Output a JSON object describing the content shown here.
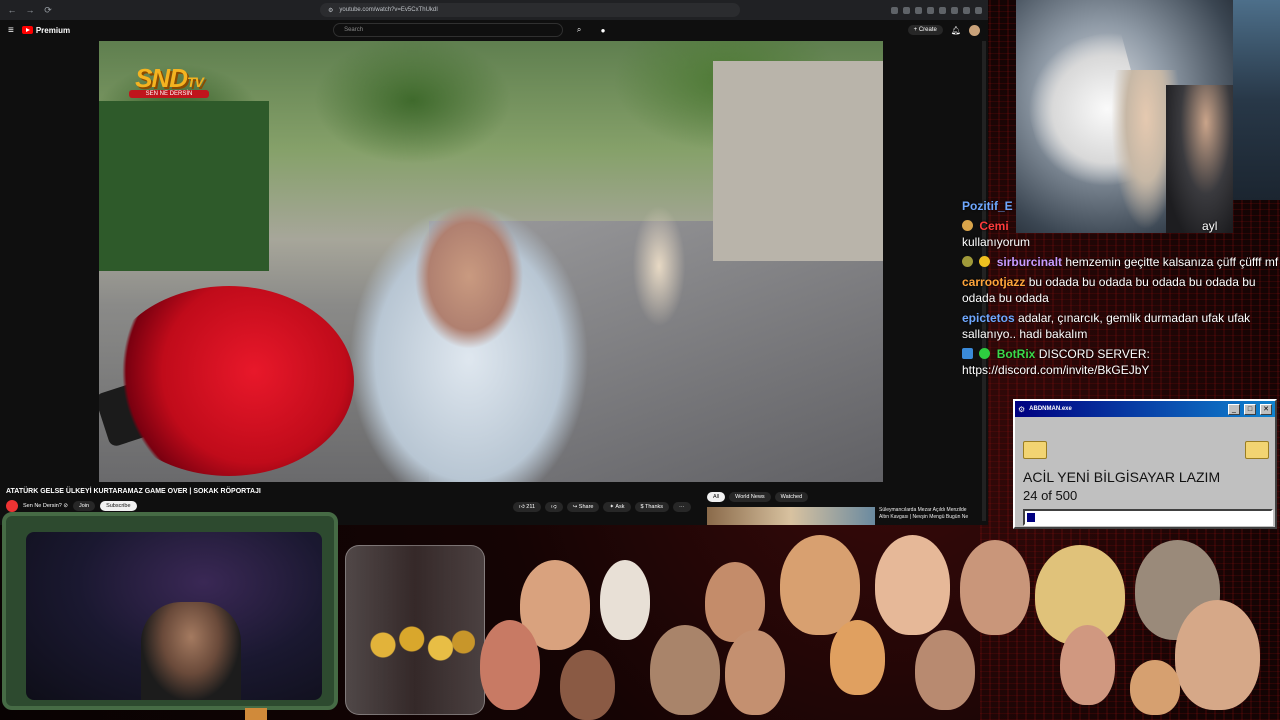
{
  "browser": {
    "url": "youtube.com/watch?v=Ev5CxThUkdI",
    "nav": {
      "back": "←",
      "forward": "→",
      "reload": "⟳"
    }
  },
  "youtube": {
    "logo_label": "Premium",
    "search_placeholder": "Search",
    "create_label": "+ Create",
    "video": {
      "overlay_logo": "SND",
      "overlay_logo_tv": "TV",
      "overlay_banner": "SEN NE DERSİN",
      "title": "ATATÜRK GELSE ÜLKEYİ KURTARAMAZ GAME OVER | SOKAK RÖPORTAJI",
      "channel": "Sen Ne Dersin? ⊘",
      "join_label": "Join",
      "subscribe_label": "Subscribe",
      "likes": "211",
      "share_label": "Share",
      "ask_label": "Ask",
      "thanks_label": "Thanks",
      "more_label": "···"
    },
    "filters": [
      "All",
      "World News",
      "Watched"
    ],
    "recommendation": {
      "line1": "Süleymancılarda Mezar Açıldı Menzilde",
      "line2": "Altın Kavgası | Nevşin Mengü Bugün Ne"
    }
  },
  "chat": {
    "messages": [
      {
        "user": "Pozitif_E",
        "color": "#6fa8ff",
        "text": ""
      },
      {
        "user": "Cemi",
        "color": "#ff3b3b",
        "text": "",
        "tail": "ayl",
        "badge": "#d9a44a"
      },
      {
        "user": "",
        "color": "#ffffff",
        "text": "kullanıyorum"
      },
      {
        "user": "sirburcinalt",
        "color": "#c79bff",
        "text": "hemzemin geçitte kalsanıza çüff çüfff mf",
        "badge": "#a09a3a",
        "badge2": "#f0c020"
      },
      {
        "user": "carrootjazz",
        "color": "#ffa53b",
        "text": "bu odada bu odada bu odada bu odada bu odada bu odada"
      },
      {
        "user": "epictetos",
        "color": "#6fa8ff",
        "text": "adalar, çınarcık, gemlik durmadan ufak ufak sallanıyo.. hadi bakalım"
      },
      {
        "user": "BotRix",
        "color": "#3bd94a",
        "text": "DISCORD SERVER: https://discord.com/invite/BkGEJbY",
        "badge": "#3a8ad9",
        "badge2": "#2ecc40"
      }
    ]
  },
  "popup": {
    "title": "ABDNMAN.exe",
    "headline": "ACİL YENİ BİLGİSAYAR LAZIM",
    "progress_text": "24 of 500",
    "progress_value": 24,
    "progress_max": 500,
    "min": "_",
    "max": "□",
    "close": "✕"
  },
  "colors": {
    "yt_red": "#ff0000",
    "win_title": "#000080",
    "win_face": "#c0c0c0"
  }
}
